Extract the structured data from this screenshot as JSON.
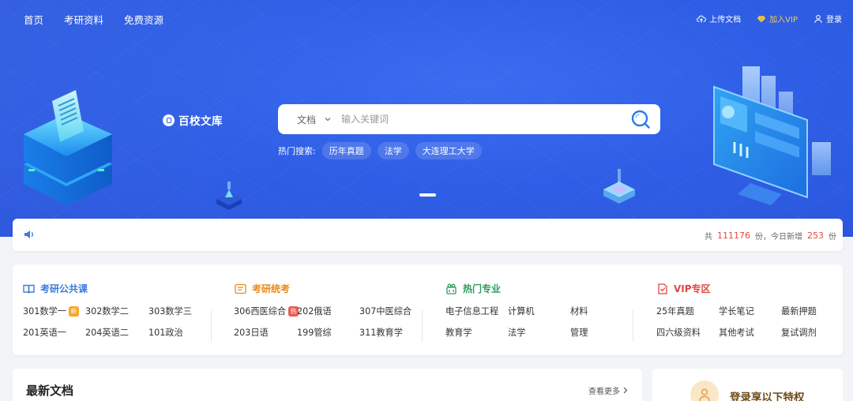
{
  "nav": {
    "items": [
      "首页",
      "考研资料",
      "免费资源"
    ],
    "upload": "上传文档",
    "vip": "加入VIP",
    "login": "登录"
  },
  "logo": {
    "text": "百校文库"
  },
  "search": {
    "type_label": "文档",
    "placeholder": "输入关键词",
    "hot_label": "热门搜索:",
    "hot_tags": [
      "历年真题",
      "法学",
      "大连理工大学"
    ]
  },
  "stats": {
    "prefix": "共",
    "total": "111176",
    "unit1": "份，今日新增",
    "today": "253",
    "unit2": "份"
  },
  "categories": [
    {
      "title": "考研公共课",
      "color": "#3d7be0",
      "icon": "book-icon",
      "items": [
        {
          "label": "301数学一",
          "badge": "新",
          "badge_color": "#f5a623"
        },
        {
          "label": "302数学二"
        },
        {
          "label": "303数学三"
        },
        {
          "label": "201英语一"
        },
        {
          "label": "204英语二"
        },
        {
          "label": "101政治"
        }
      ]
    },
    {
      "title": "考研统考",
      "color": "#e98a1f",
      "icon": "exam-icon",
      "items": [
        {
          "label": "306西医综合",
          "badge": "热",
          "badge_color": "#ec5b50"
        },
        {
          "label": "202俄语"
        },
        {
          "label": "307中医综合"
        },
        {
          "label": "203日语"
        },
        {
          "label": "199管综"
        },
        {
          "label": "311教育学"
        }
      ]
    },
    {
      "title": "热门专业",
      "color": "#2e9a5b",
      "icon": "major-icon",
      "items": [
        {
          "label": "电子信息工程"
        },
        {
          "label": "计算机"
        },
        {
          "label": "材料"
        },
        {
          "label": "教育学"
        },
        {
          "label": "法学"
        },
        {
          "label": "管理"
        }
      ]
    },
    {
      "title": "VIP专区",
      "color": "#e0463f",
      "icon": "vip-doc-icon",
      "items": [
        {
          "label": "25年真题"
        },
        {
          "label": "学长笔记"
        },
        {
          "label": "最新押题"
        },
        {
          "label": "四六级资料"
        },
        {
          "label": "其他考试"
        },
        {
          "label": "复试调剂"
        }
      ]
    }
  ],
  "latest": {
    "title": "最新文档",
    "more": "查看更多"
  },
  "privilege": {
    "title": "登录享以下特权"
  }
}
